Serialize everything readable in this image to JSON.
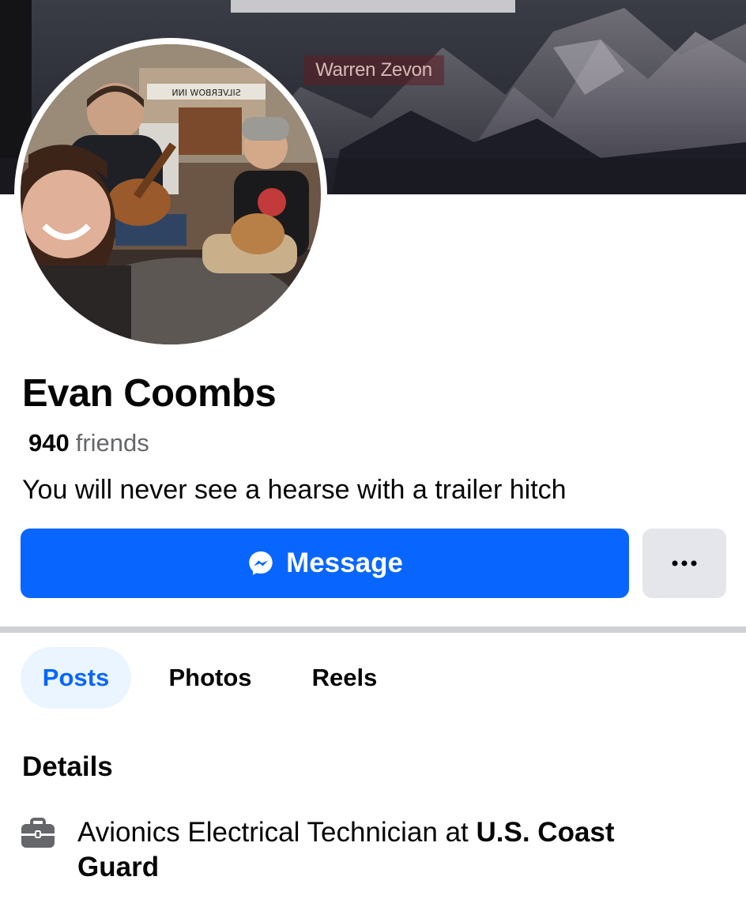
{
  "cover": {
    "caption": "Warren Zevon",
    "sign_text": "SILVERBOW INN"
  },
  "profile": {
    "name": "Evan Coombs",
    "friends_count": "940",
    "friends_label": "friends",
    "bio": "You will never see a hearse with a trailer hitch"
  },
  "actions": {
    "message_label": "Message",
    "more_label": "More options"
  },
  "tabs": [
    {
      "label": "Posts",
      "active": true
    },
    {
      "label": "Photos",
      "active": false
    },
    {
      "label": "Reels",
      "active": false
    }
  ],
  "details": {
    "title": "Details",
    "work": {
      "role_prefix": "Avionics Electrical Technician at ",
      "employer": "U.S. Coast Guard"
    }
  },
  "icons": {
    "messenger": "messenger-icon",
    "more": "more-horizontal-icon",
    "work": "briefcase-icon"
  },
  "colors": {
    "primary_blue": "#0866ff",
    "active_tab_bg": "#ebf5ff",
    "secondary_button": "#e4e6eb",
    "muted_text": "#65676b"
  }
}
